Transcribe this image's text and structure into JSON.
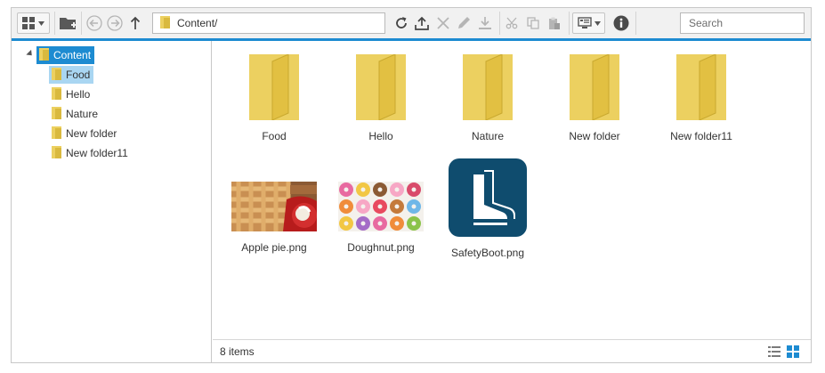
{
  "address": {
    "path": "Content/"
  },
  "search": {
    "placeholder": "Search"
  },
  "toolbar": {
    "buttons": [
      "view-mode",
      "new-folder",
      "back",
      "forward",
      "up",
      "refresh",
      "upload",
      "delete",
      "rename",
      "download",
      "cut",
      "copy",
      "paste",
      "details-pane",
      "info"
    ],
    "accent_color": "#1d8bd1"
  },
  "tree": {
    "root": "Content",
    "children": [
      {
        "label": "Food",
        "selected": true
      },
      {
        "label": "Hello"
      },
      {
        "label": "Nature"
      },
      {
        "label": "New folder"
      },
      {
        "label": "New folder11"
      }
    ]
  },
  "items": [
    {
      "name": "Food",
      "type": "folder"
    },
    {
      "name": "Hello",
      "type": "folder"
    },
    {
      "name": "Nature",
      "type": "folder"
    },
    {
      "name": "New folder",
      "type": "folder"
    },
    {
      "name": "New folder11",
      "type": "folder"
    },
    {
      "name": "Apple pie.png",
      "type": "image"
    },
    {
      "name": "Doughnut.png",
      "type": "image"
    },
    {
      "name": "SafetyBoot.png",
      "type": "image"
    }
  ],
  "status": {
    "count": "8 items",
    "view": "large-icons"
  },
  "colors": {
    "folder": "#ecd060",
    "selection": "#1d8bd1",
    "selection_light": "#a9d6f2",
    "boot_tile": "#0f4c6e"
  }
}
